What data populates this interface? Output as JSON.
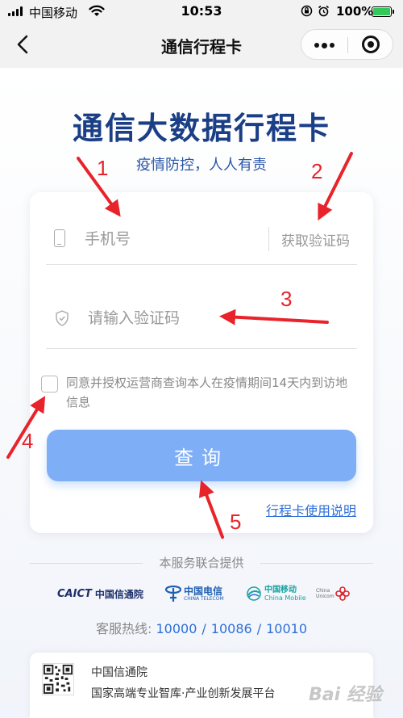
{
  "status_bar": {
    "carrier": "中国移动",
    "time": "10:53",
    "battery": "100%"
  },
  "nav": {
    "title": "通信行程卡"
  },
  "headline": "通信大数据行程卡",
  "slogan": "疫情防控，人人有责",
  "form": {
    "phone_placeholder": "手机号",
    "get_code_label": "获取验证码",
    "code_placeholder": "请输入验证码",
    "agreement_text": "同意并授权运营商查询本人在疫情期间14天内到访地信息",
    "submit_label": "查询",
    "guide_link": "行程卡使用说明"
  },
  "footer": {
    "caption": "本服务联合提供",
    "logos": {
      "caict_mark": "CAICT",
      "caict_cn": "中国信通院",
      "telecom_cn": "中国电信",
      "telecom_en": "CHINA TELECOM",
      "mobile_cn": "中国移动",
      "mobile_en": "China Mobile",
      "unicom_en": "China Unicom"
    },
    "hotline_label": "客服热线:",
    "hotlines": [
      "10000",
      "10086",
      "10010"
    ]
  },
  "bottom_card": {
    "org_name": "中国信通院",
    "org_desc": "国家高端专业智库·产业创新发展平台"
  },
  "watermark": "Bai 经验",
  "annotations": [
    "1",
    "2",
    "3",
    "4",
    "5"
  ],
  "colors": {
    "headline": "#1b3f86",
    "button": "#7eaef5",
    "link": "#2f6fd8",
    "annotation": "#e8232a"
  }
}
